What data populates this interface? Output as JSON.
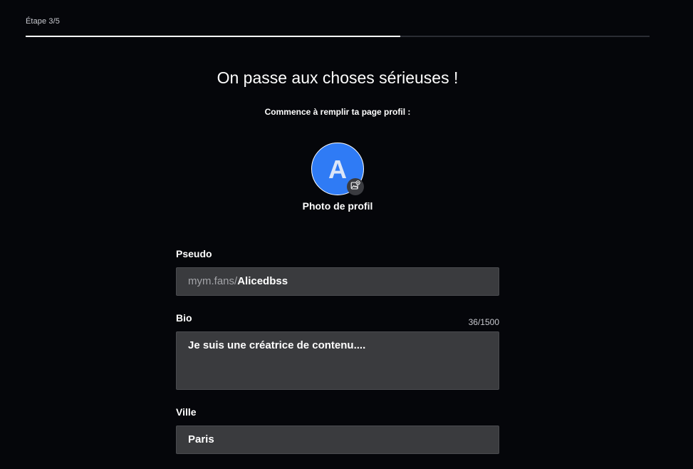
{
  "header": {
    "step_label": "Étape 3/5",
    "progress_fraction": 0.6
  },
  "main": {
    "title": "On passe aux choses sérieuses !",
    "subtitle": "Commence à remplir ta page profil :"
  },
  "avatar": {
    "initial": "A",
    "caption": "Photo de profil",
    "edit_icon": "image-add-icon",
    "color": "#2f7bf5"
  },
  "form": {
    "pseudo": {
      "label": "Pseudo",
      "prefix": "mym.fans/",
      "value": "Alicedbss"
    },
    "bio": {
      "label": "Bio",
      "counter": "36/1500",
      "value": "Je suis une créatrice de contenu...."
    },
    "ville": {
      "label": "Ville",
      "value": "Paris"
    }
  },
  "colors": {
    "background": "#05060a",
    "field_background": "#3a3b3e",
    "progress": "#ffffff"
  }
}
